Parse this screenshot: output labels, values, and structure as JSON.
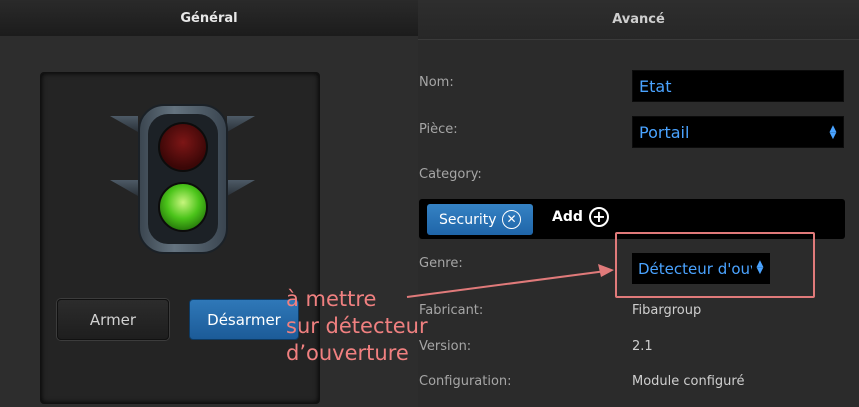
{
  "tabs": {
    "general": "Général",
    "advanced": "Avancé"
  },
  "device": {
    "icon": "traffic-light-icon",
    "arm_label": "Armer",
    "disarm_label": "Désarmer"
  },
  "fields": {
    "name_label": "Nom:",
    "name_value": "Etat",
    "room_label": "Pièce:",
    "room_value": "Portail",
    "category_label": "Category:",
    "category_chip": "Security",
    "add_label": "Add",
    "genre_label": "Genre:",
    "genre_value": "Détecteur d'ouverture",
    "manufacturer_label": "Fabricant:",
    "manufacturer_value": "Fibargroup",
    "version_label": "Version:",
    "version_value": "2.1",
    "config_label": "Configuration:",
    "config_value": "Module configuré"
  },
  "annotation": {
    "line1": "à mettre",
    "line2": "sur détecteur",
    "line3": "d’ouverture"
  },
  "colors": {
    "accent": "#2f78b8",
    "link": "#4aa3ff",
    "annotation": "#e07a7a"
  }
}
